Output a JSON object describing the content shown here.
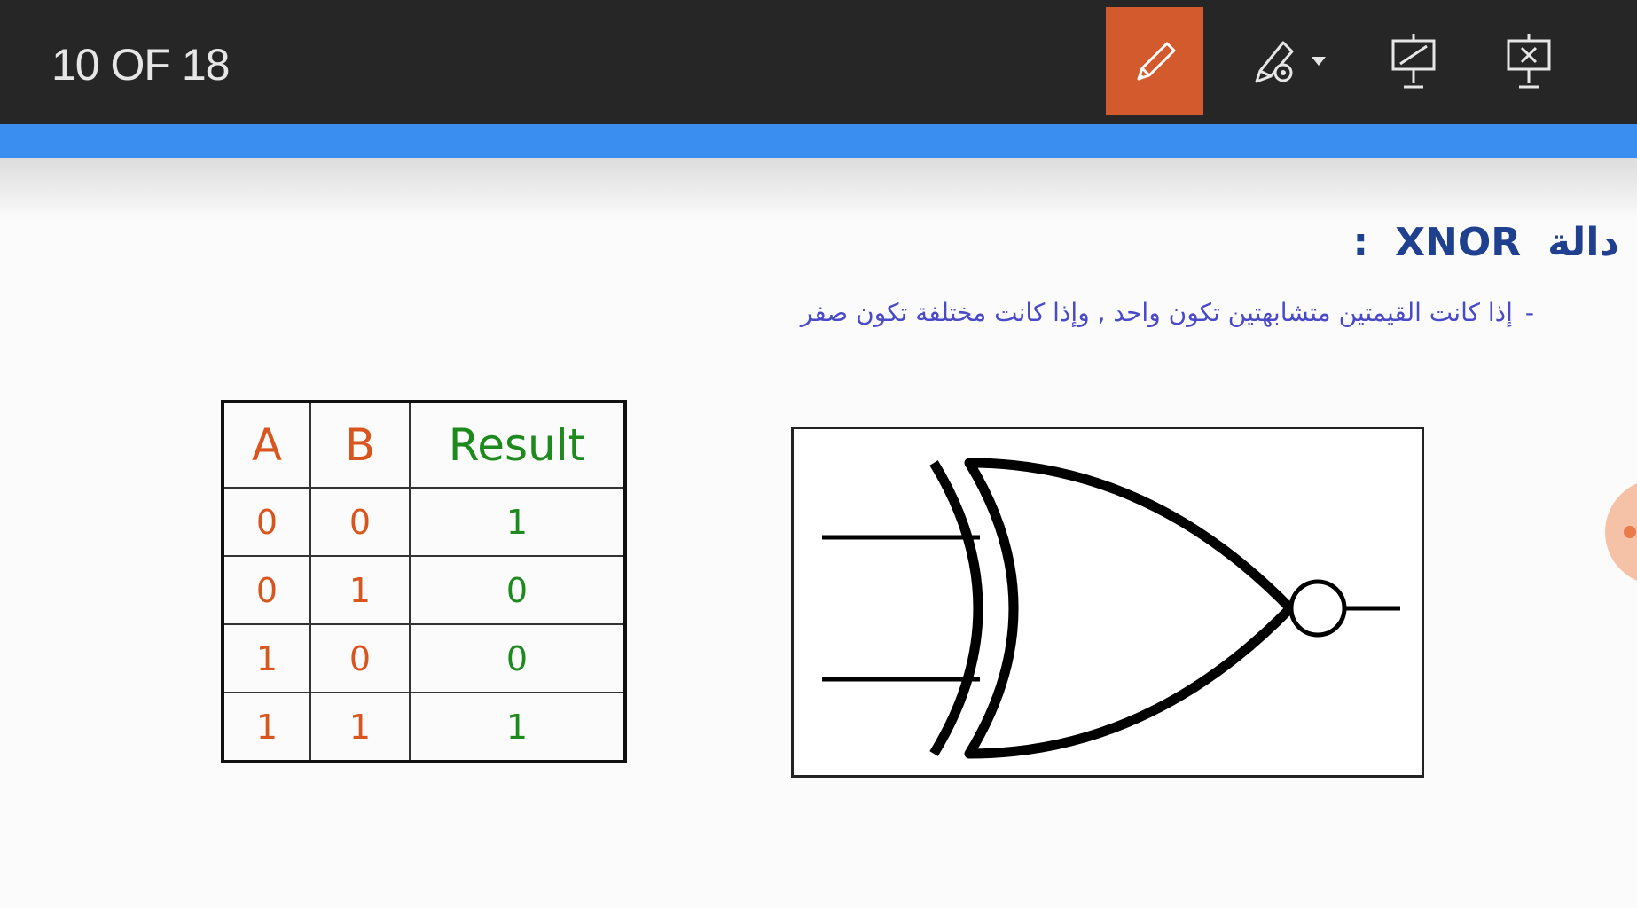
{
  "toolbar": {
    "slide_counter": "10 OF 18",
    "buttons": [
      {
        "name": "pen-tool",
        "icon": "pen-icon",
        "active": true
      },
      {
        "name": "pen-options",
        "icon": "pen-settings-icon"
      },
      {
        "name": "monitor",
        "icon": "projector-screen-icon"
      },
      {
        "name": "end-show",
        "icon": "end-show-icon"
      }
    ],
    "active_color": "#d35a2c",
    "accent_bar_color": "#3a8ef0"
  },
  "slide": {
    "heading_word": "دالة",
    "heading_term": "XNOR",
    "heading_colon": ":",
    "subtitle_dash": "-",
    "subtitle": "إذا كانت القيمتين متشابهتين تكون واحد , وإذا كانت مختلفة تكون صفر",
    "truth_table": {
      "headers": [
        "A",
        "B",
        "Result"
      ],
      "rows": [
        [
          "0",
          "0",
          "1"
        ],
        [
          "0",
          "1",
          "0"
        ],
        [
          "1",
          "0",
          "0"
        ],
        [
          "1",
          "1",
          "1"
        ]
      ]
    },
    "diagram": {
      "icon": "xnor-gate-symbol"
    }
  }
}
